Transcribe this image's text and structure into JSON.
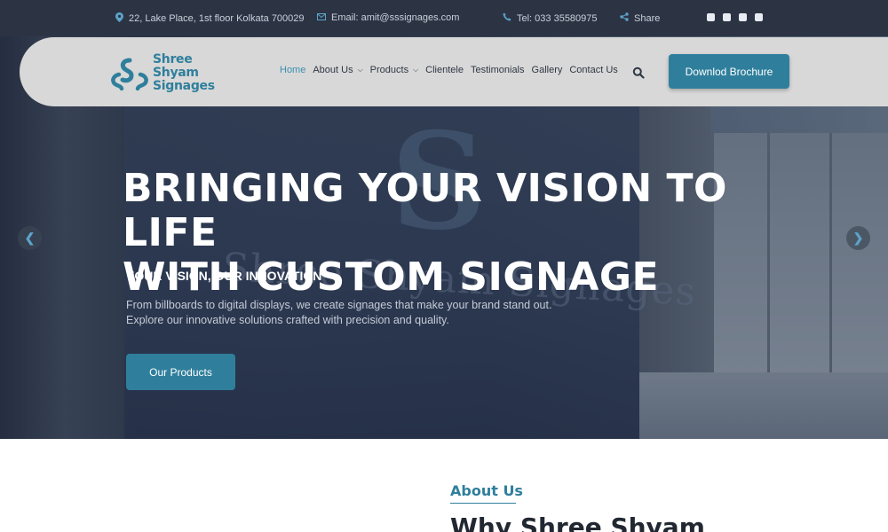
{
  "topbar": {
    "address": "22, Lake Place, 1st floor Kolkata 700029",
    "email": "Email: amit@sssignages.com",
    "phone": "Tel: 033 35580975",
    "share": "Share",
    "social": [
      "facebook-icon",
      "instagram-icon",
      "linkedin-icon",
      "youtube-icon"
    ]
  },
  "logo": {
    "line1": "Shree",
    "line2": "Shyam",
    "line3": "Signages"
  },
  "nav": {
    "items": [
      {
        "label": "Home"
      },
      {
        "label": "About Us"
      },
      {
        "label": "Products"
      },
      {
        "label": "Clientele"
      },
      {
        "label": "Testimonials"
      },
      {
        "label": "Gallery"
      },
      {
        "label": "Contact Us"
      }
    ],
    "brochure_label": "Downlod Brochure"
  },
  "hero": {
    "headline_line1": "BRINGING YOUR VISION TO LIFE",
    "headline_line2": "WITH CUSTOM SIGNAGE",
    "subheading": "YOUR VISION, OUR INNOVATION",
    "desc_line1": "From billboards to digital displays, we create signages that make your brand stand out.",
    "desc_line2": "Explore our innovative solutions crafted with precision and quality.",
    "cta_label": "Our Products",
    "wall_logo_letter": "S",
    "wall_text": "Shree Shyam Signages"
  },
  "about": {
    "label": "About Us",
    "title": "Why Shree Shyam"
  },
  "colors": {
    "brand": "#2f7f9c",
    "topbar": "#2c3444",
    "navbar": "#d8d8d8"
  }
}
